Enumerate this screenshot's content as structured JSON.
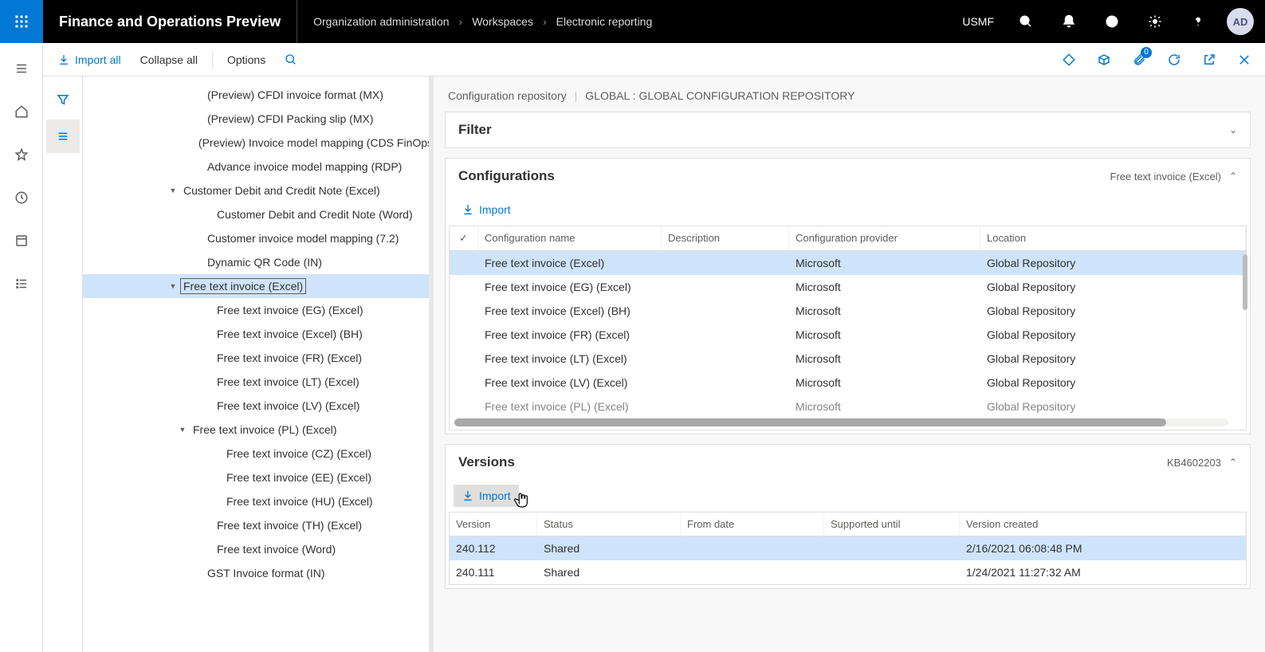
{
  "app_title": "Finance and Operations Preview",
  "breadcrumb": [
    "Organization administration",
    "Workspaces",
    "Electronic reporting"
  ],
  "company": "USMF",
  "avatar": "AD",
  "actionbar": {
    "import_all": "Import all",
    "collapse_all": "Collapse all",
    "options": "Options",
    "notification_count": "0"
  },
  "tree_items": [
    {
      "label": "(Preview) CFDI invoice format (MX)",
      "indent": "indent-2",
      "arrow": ""
    },
    {
      "label": "(Preview) CFDI Packing slip (MX)",
      "indent": "indent-2",
      "arrow": ""
    },
    {
      "label": "(Preview) Invoice model mapping (CDS FinOps)",
      "indent": "indent-2",
      "arrow": ""
    },
    {
      "label": "Advance invoice model mapping (RDP)",
      "indent": "indent-2",
      "arrow": ""
    },
    {
      "label": "Customer Debit and Credit Note (Excel)",
      "indent": "indent-1a",
      "arrow": "▾"
    },
    {
      "label": "Customer Debit and Credit Note (Word)",
      "indent": "indent-3",
      "arrow": ""
    },
    {
      "label": "Customer invoice model mapping (7.2)",
      "indent": "indent-2",
      "arrow": ""
    },
    {
      "label": "Dynamic QR Code (IN)",
      "indent": "indent-2",
      "arrow": ""
    },
    {
      "label": "Free text invoice (Excel)",
      "indent": "indent-1a",
      "arrow": "▾",
      "selected": true
    },
    {
      "label": "Free text invoice (EG) (Excel)",
      "indent": "indent-3",
      "arrow": ""
    },
    {
      "label": "Free text invoice (Excel) (BH)",
      "indent": "indent-3",
      "arrow": ""
    },
    {
      "label": "Free text invoice (FR) (Excel)",
      "indent": "indent-3",
      "arrow": ""
    },
    {
      "label": "Free text invoice (LT) (Excel)",
      "indent": "indent-3",
      "arrow": ""
    },
    {
      "label": "Free text invoice (LV) (Excel)",
      "indent": "indent-3",
      "arrow": ""
    },
    {
      "label": "Free text invoice (PL) (Excel)",
      "indent": "indent-1a",
      "arrow": "▾",
      "indentOverride": "indent-2a"
    },
    {
      "label": "Free text invoice (CZ) (Excel)",
      "indent": "indent-4",
      "arrow": ""
    },
    {
      "label": "Free text invoice (EE) (Excel)",
      "indent": "indent-4",
      "arrow": ""
    },
    {
      "label": "Free text invoice (HU) (Excel)",
      "indent": "indent-4",
      "arrow": ""
    },
    {
      "label": "Free text invoice (TH) (Excel)",
      "indent": "indent-3",
      "arrow": ""
    },
    {
      "label": "Free text invoice (Word)",
      "indent": "indent-3",
      "arrow": ""
    },
    {
      "label": "GST Invoice format (IN)",
      "indent": "indent-2",
      "arrow": ""
    }
  ],
  "repo": {
    "label": "Configuration repository",
    "value": "GLOBAL : GLOBAL CONFIGURATION REPOSITORY"
  },
  "filter_panel": {
    "title": "Filter"
  },
  "configs_panel": {
    "title": "Configurations",
    "subtitle": "Free text invoice (Excel)",
    "import": "Import",
    "columns": [
      "",
      "Configuration name",
      "Description",
      "Configuration provider",
      "Location"
    ],
    "rows": [
      {
        "name": "Free text invoice (Excel)",
        "desc": "",
        "provider": "Microsoft",
        "loc": "Global Repository",
        "selected": true
      },
      {
        "name": "Free text invoice (EG) (Excel)",
        "desc": "",
        "provider": "Microsoft",
        "loc": "Global Repository"
      },
      {
        "name": "Free text invoice (Excel) (BH)",
        "desc": "",
        "provider": "Microsoft",
        "loc": "Global Repository"
      },
      {
        "name": "Free text invoice (FR) (Excel)",
        "desc": "",
        "provider": "Microsoft",
        "loc": "Global Repository"
      },
      {
        "name": "Free text invoice (LT) (Excel)",
        "desc": "",
        "provider": "Microsoft",
        "loc": "Global Repository"
      },
      {
        "name": "Free text invoice (LV) (Excel)",
        "desc": "",
        "provider": "Microsoft",
        "loc": "Global Repository"
      },
      {
        "name": "Free text invoice (PL) (Excel)",
        "desc": "",
        "provider": "Microsoft",
        "loc": "Global Repository",
        "cut": true
      }
    ]
  },
  "versions_panel": {
    "title": "Versions",
    "subtitle": "KB4602203",
    "import": "Import",
    "columns": [
      "Version",
      "Status",
      "From date",
      "Supported until",
      "Version created"
    ],
    "rows": [
      {
        "version": "240.112",
        "status": "Shared",
        "from": "",
        "until": "",
        "created": "2/16/2021 06:08:48 PM",
        "selected": true
      },
      {
        "version": "240.111",
        "status": "Shared",
        "from": "",
        "until": "",
        "created": "1/24/2021 11:27:32 AM"
      }
    ]
  }
}
